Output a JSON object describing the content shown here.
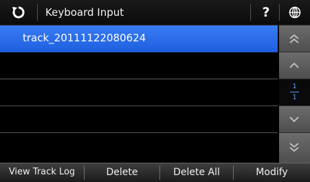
{
  "header": {
    "title": "Keyboard Input",
    "help_label": "?"
  },
  "list": {
    "items": [
      {
        "label": "track_20111122080624",
        "selected": true
      },
      {
        "label": "",
        "selected": false
      },
      {
        "label": "",
        "selected": false
      },
      {
        "label": "",
        "selected": false
      },
      {
        "label": "",
        "selected": false
      }
    ]
  },
  "scroller": {
    "current_page": "1",
    "total_pages": "1"
  },
  "bottom_bar": {
    "view_track_log": "View Track Log",
    "delete": "Delete",
    "delete_all": "Delete All",
    "modify": "Modify"
  },
  "icons": {
    "back": "circular-arrow-icon",
    "help": "question-mark-icon",
    "language": "globe-icon",
    "page_top": "double-chevron-up-icon",
    "page_up": "chevron-up-icon",
    "page_down": "chevron-down-icon",
    "page_bottom": "double-chevron-down-icon"
  },
  "colors": {
    "selected_row": "#1d5fe0",
    "page_indicator": "#5aa0ff"
  }
}
